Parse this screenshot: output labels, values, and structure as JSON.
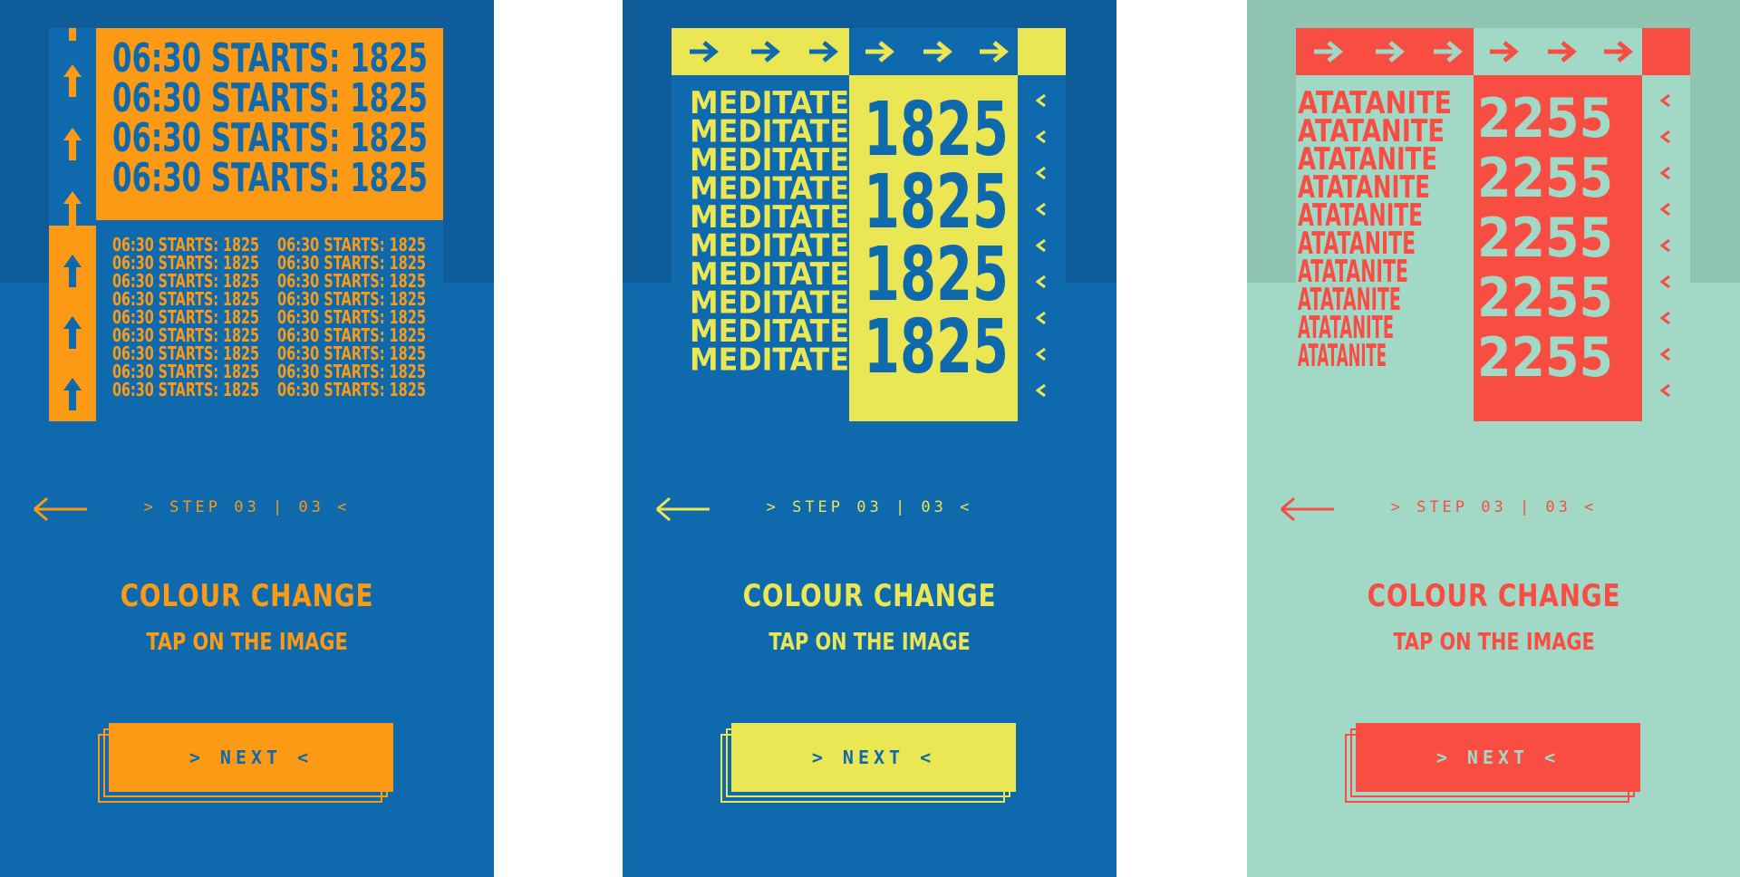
{
  "colors": {
    "blue": "#0f69ad",
    "blue_dark": "#0f5c9a",
    "orange": "#fd9a15",
    "yellow": "#ebe654",
    "mint": "#a2d9c6",
    "mint_dark": "#8fc3b2",
    "coral": "#f84d42"
  },
  "screens": [
    {
      "id": "orange",
      "step": "> STEP 03 | 03 <",
      "title": "COLOUR CHANGE",
      "subtitle": "TAP ON THE IMAGE",
      "button": "> NEXT <",
      "art_big_line": "06:30 STARTS: 1825",
      "art_small_line": "06:30 STARTS: 1825"
    },
    {
      "id": "yellow",
      "step": "> STEP 03 | 03 <",
      "title": "COLOUR CHANGE",
      "subtitle": "TAP ON THE IMAGE",
      "button": "> NEXT <",
      "art_word": "MEDITATE",
      "art_number": "1825"
    },
    {
      "id": "coral",
      "step": "> STEP 03 | 03 <",
      "title": "COLOUR CHANGE",
      "subtitle": "TAP ON THE IMAGE",
      "button": "> NEXT <",
      "art_word": "ATATANITE",
      "art_number": "2255"
    }
  ]
}
